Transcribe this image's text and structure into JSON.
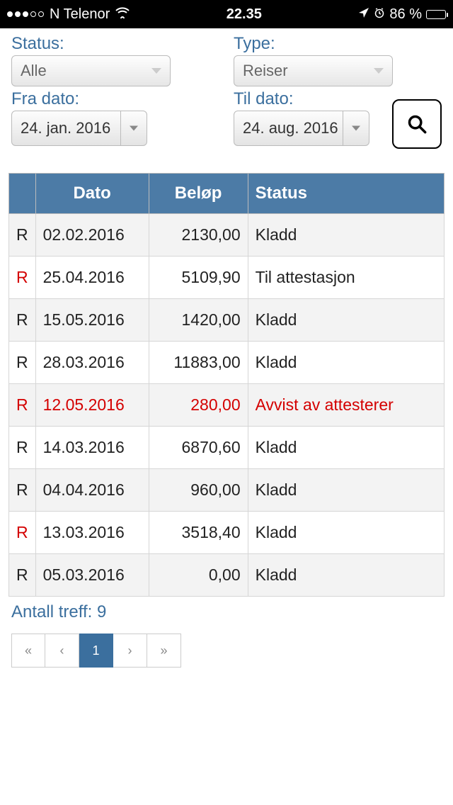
{
  "status_bar": {
    "carrier": "N Telenor",
    "time": "22.35",
    "battery_pct": "86 %"
  },
  "filters": {
    "status_label": "Status:",
    "status_value": "Alle",
    "type_label": "Type:",
    "type_value": "Reiser",
    "from_label": "Fra dato:",
    "from_value": "24. jan. 2016",
    "to_label": "Til dato:",
    "to_value": "24. aug. 2016"
  },
  "table": {
    "headers": {
      "type": "",
      "date": "Dato",
      "amount": "Beløp",
      "status": "Status"
    },
    "rows": [
      {
        "r": "R",
        "r_red": false,
        "date": "02.02.2016",
        "amount": "2130,00",
        "status": "Kladd",
        "rejected": false
      },
      {
        "r": "R",
        "r_red": true,
        "date": "25.04.2016",
        "amount": "5109,90",
        "status": "Til attestasjon",
        "rejected": false
      },
      {
        "r": "R",
        "r_red": false,
        "date": "15.05.2016",
        "amount": "1420,00",
        "status": "Kladd",
        "rejected": false
      },
      {
        "r": "R",
        "r_red": false,
        "date": "28.03.2016",
        "amount": "11883,00",
        "status": "Kladd",
        "rejected": false
      },
      {
        "r": "R",
        "r_red": true,
        "date": "12.05.2016",
        "amount": "280,00",
        "status": "Avvist av attesterer",
        "rejected": true
      },
      {
        "r": "R",
        "r_red": false,
        "date": "14.03.2016",
        "amount": "6870,60",
        "status": "Kladd",
        "rejected": false
      },
      {
        "r": "R",
        "r_red": false,
        "date": "04.04.2016",
        "amount": "960,00",
        "status": "Kladd",
        "rejected": false
      },
      {
        "r": "R",
        "r_red": true,
        "date": "13.03.2016",
        "amount": "3518,40",
        "status": "Kladd",
        "rejected": false
      },
      {
        "r": "R",
        "r_red": false,
        "date": "05.03.2016",
        "amount": "0,00",
        "status": "Kladd",
        "rejected": false
      }
    ]
  },
  "result_count": "Antall treff: 9",
  "pagination": {
    "first": "«",
    "prev": "‹",
    "current": "1",
    "next": "›",
    "last": "»"
  }
}
